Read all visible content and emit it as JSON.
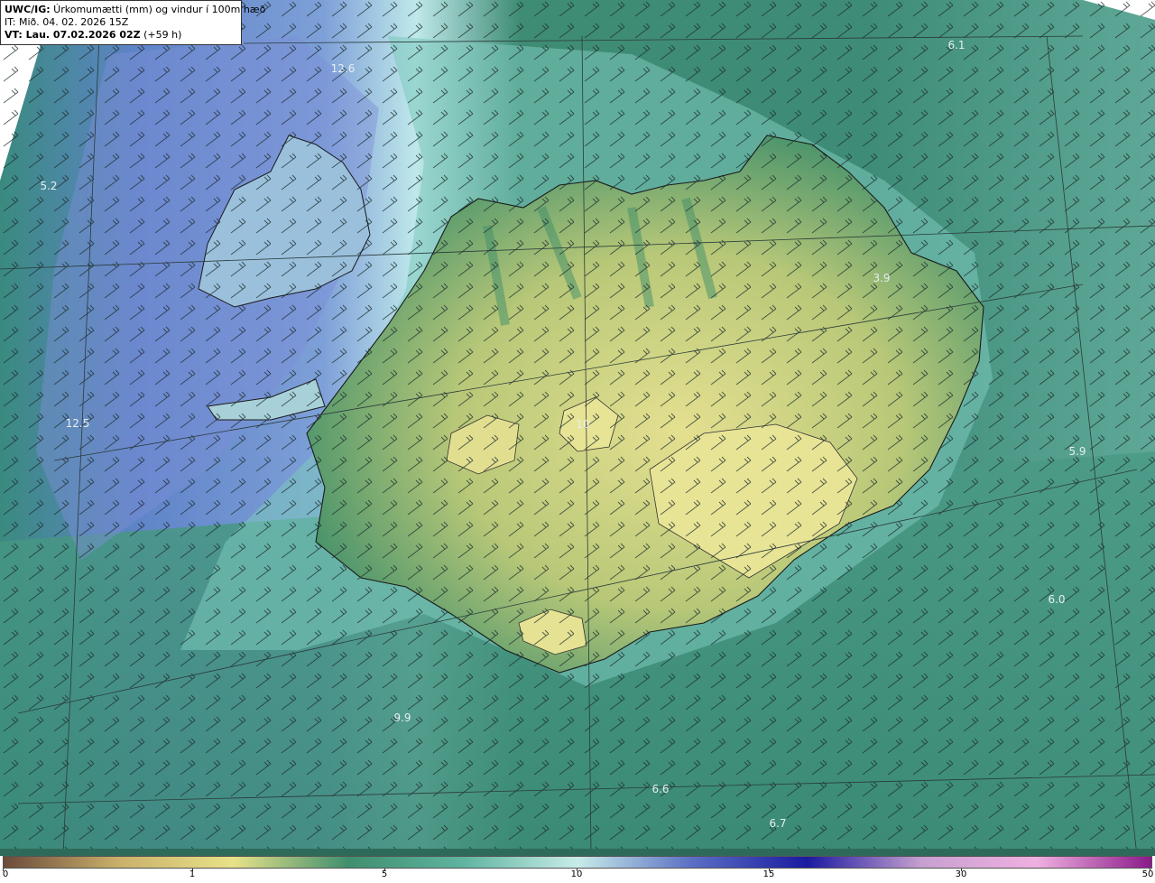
{
  "header": {
    "line1_bold": "UWC/IG:",
    "line1_rest": " Úrkomumætti (mm) og vindur í 100m hæð",
    "line2": "IT: Mið. 04. 02. 2026 15Z",
    "line3_bold": "VT:",
    "line3_bold2": " Lau. 07.02.2026 02Z",
    "line3_rest": " (+59 h)"
  },
  "labels": [
    {
      "text": "12.6"
    },
    {
      "text": "6.1"
    },
    {
      "text": "5.2"
    },
    {
      "text": "3.9"
    },
    {
      "text": "12.5"
    },
    {
      "text": "5.9"
    },
    {
      "text": "6.0"
    },
    {
      "text": "6.6"
    },
    {
      "text": "6.7"
    },
    {
      "text": "10"
    },
    {
      "text": "9.9"
    }
  ],
  "colorbar": {
    "ticks": [
      "0",
      "1",
      "5",
      "10",
      "15",
      "30",
      "50"
    ],
    "colors": [
      "#6b4a3a",
      "#c9b06a",
      "#e8e288",
      "#3f8f6e",
      "#5fb4a0",
      "#c8ece8",
      "#5a6fc4",
      "#1a1aa0",
      "#c7a0d0",
      "#f0b0e0",
      "#8a1a8a"
    ]
  },
  "colors": {
    "ocean_teal": "#3c8c7c",
    "shelf_cyan": "#8ed6cc",
    "west_blue": "#6f86cc",
    "land_yellow": "#d4d47c",
    "land_green": "#4e9c6c"
  }
}
